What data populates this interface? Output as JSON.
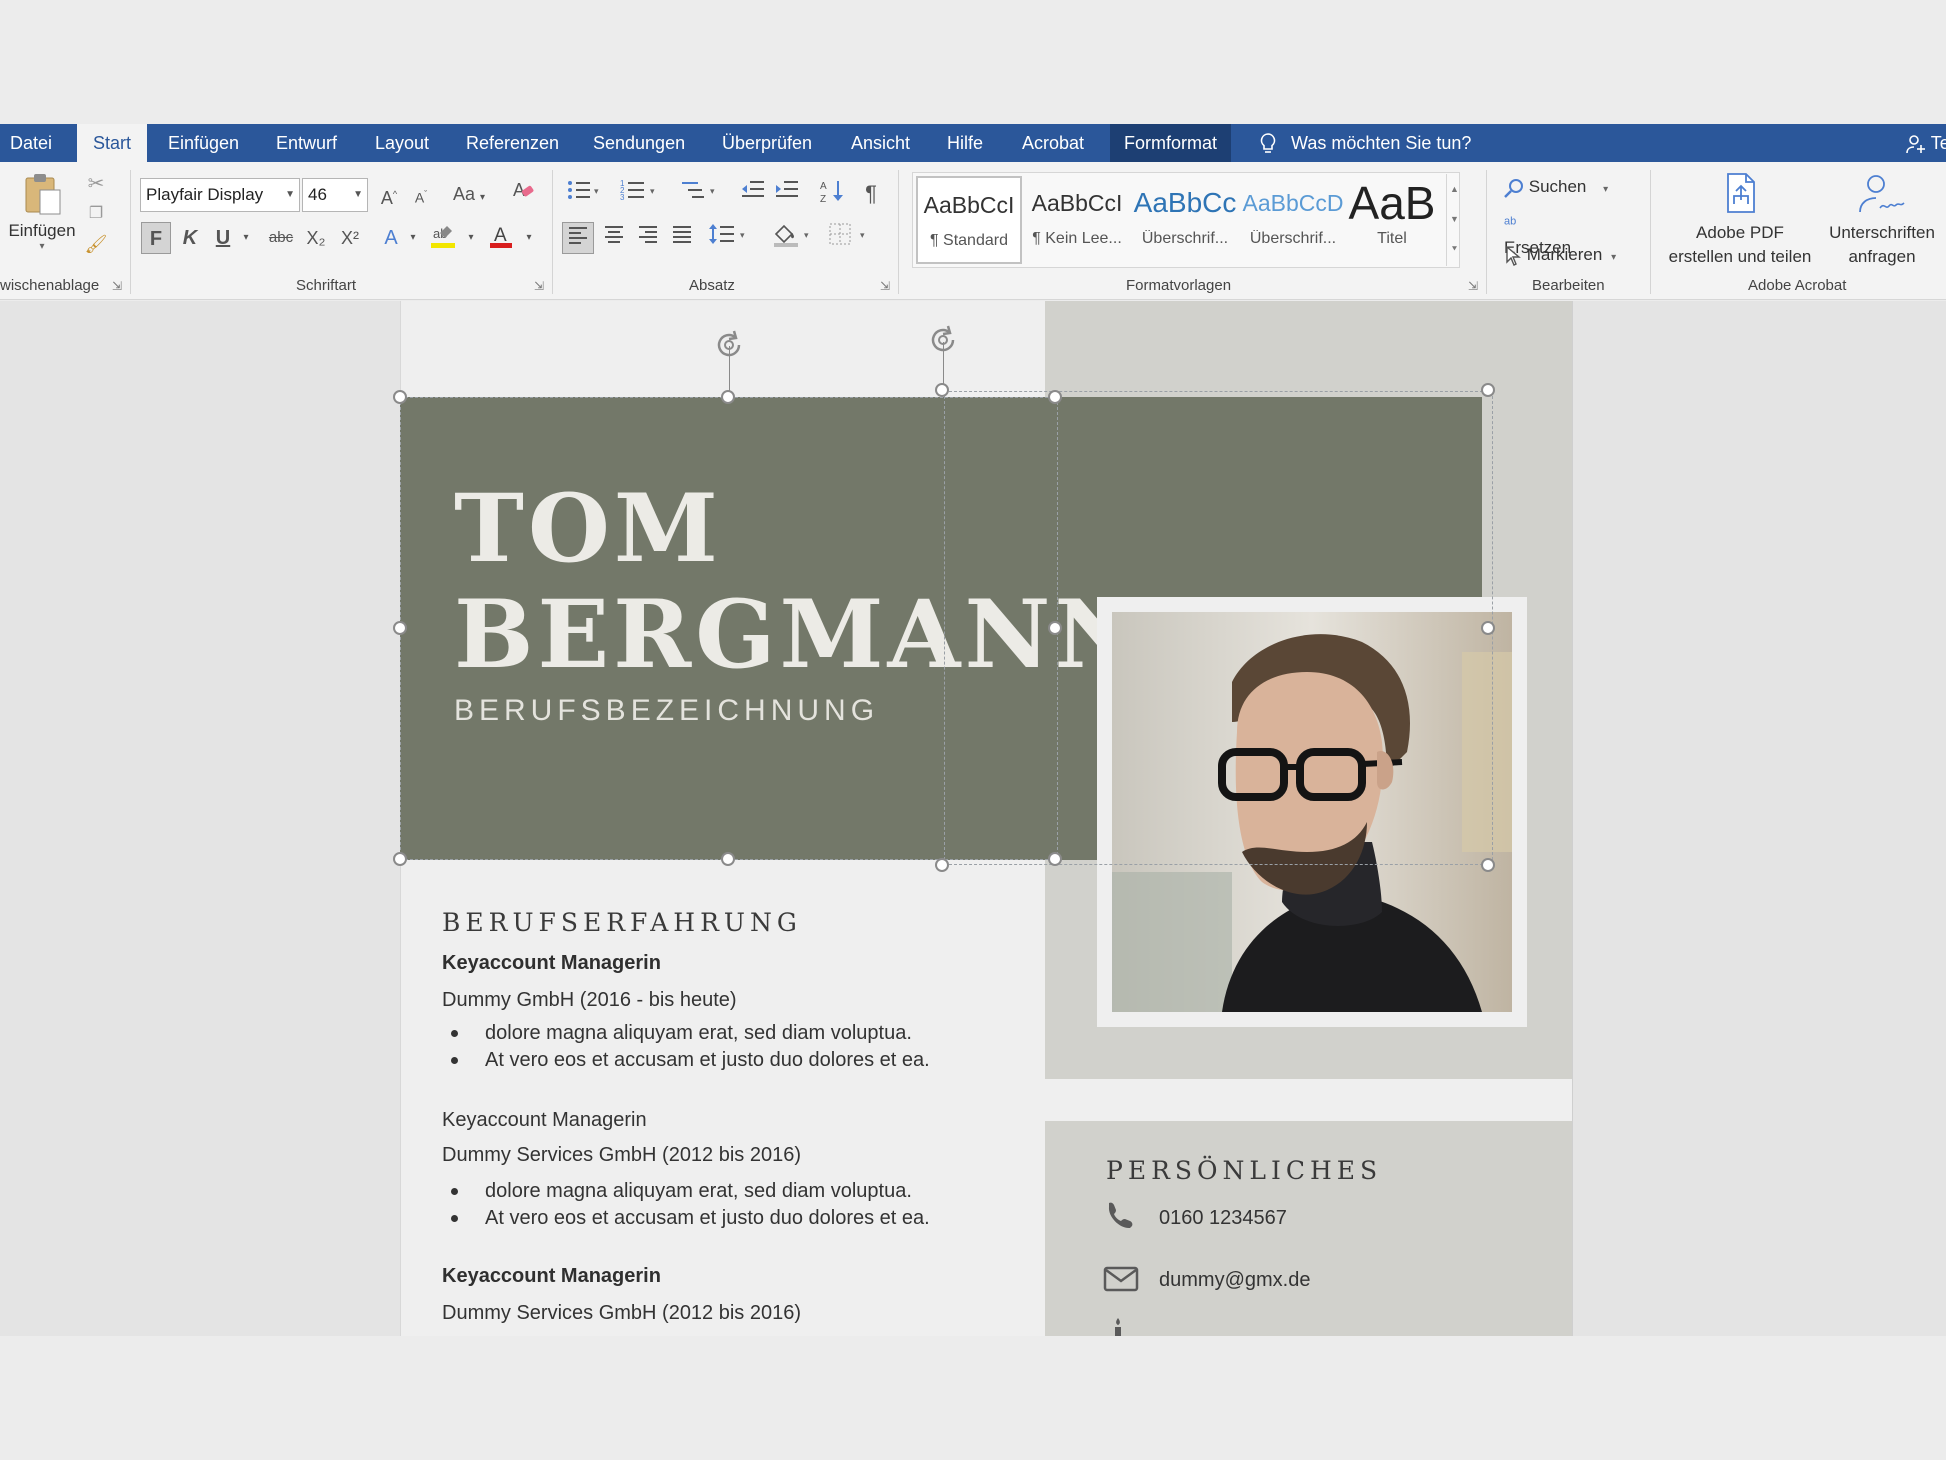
{
  "menu": {
    "tabs": [
      {
        "label": "Datei",
        "active": false
      },
      {
        "label": "Start",
        "active": true
      },
      {
        "label": "Einfügen",
        "active": false
      },
      {
        "label": "Entwurf",
        "active": false
      },
      {
        "label": "Layout",
        "active": false
      },
      {
        "label": "Referenzen",
        "active": false
      },
      {
        "label": "Sendungen",
        "active": false
      },
      {
        "label": "Überprüfen",
        "active": false
      },
      {
        "label": "Ansicht",
        "active": false
      },
      {
        "label": "Hilfe",
        "active": false
      },
      {
        "label": "Acrobat",
        "active": false
      },
      {
        "label": "Formformat",
        "active": false
      }
    ],
    "tell_me": "Was möchten Sie tun?",
    "share_partial": "Te"
  },
  "ribbon": {
    "clipboard": {
      "paste_label": "Einfügen",
      "group_label": "wischenablage"
    },
    "font": {
      "font_name": "Playfair Display",
      "font_size": "46",
      "group_label": "Schriftart",
      "bold": "F",
      "italic": "K",
      "underline": "U",
      "strike": "abc",
      "sub": "X₂",
      "sup": "X²",
      "grow": "A",
      "shrink": "A",
      "case": "Aa"
    },
    "paragraph": {
      "group_label": "Absatz",
      "pilcrow": "¶"
    },
    "styles": {
      "group_label": "Formatvorlagen",
      "items": [
        {
          "sample": "AaBbCcI",
          "name": "¶ Standard",
          "color": "#222222"
        },
        {
          "sample": "AaBbCcI",
          "name": "¶ Kein Lee...",
          "color": "#222222"
        },
        {
          "sample": "AaBbCc",
          "name": "Überschrif...",
          "color": "#2e74b5"
        },
        {
          "sample": "AaBbCcD",
          "name": "Überschrif...",
          "color": "#5b9bd5"
        },
        {
          "sample": "AaB",
          "name": "Titel",
          "color": "#222222"
        }
      ]
    },
    "editing": {
      "group_label": "Bearbeiten",
      "find": "Suchen",
      "replace": "Ersetzen",
      "select": "Markieren"
    },
    "acrobat": {
      "group_label": "Adobe Acrobat",
      "create_pdf_line1": "Adobe PDF",
      "create_pdf_line2": "erstellen und teilen",
      "sign_line1": "Unterschriften",
      "sign_line2": "anfragen"
    }
  },
  "document": {
    "first_name": "TOM",
    "last_name": "BERGMANN",
    "profession": "BERUFSBEZEICHNUNG",
    "header_color": "#737869",
    "experience": {
      "title": "BERUFSERFAHRUNG",
      "jobs": [
        {
          "role": "Keyaccount Managerin",
          "company": "Dummy GmbH (2016 - bis heute)",
          "bullets": [
            "dolore magna aliquyam erat, sed diam voluptua.",
            "At vero eos et accusam et justo duo dolores et ea."
          ]
        },
        {
          "role": "Keyaccount Managerin",
          "company": "Dummy Services GmbH (2012 bis 2016)",
          "bullets": [
            "dolore magna aliquyam erat, sed diam voluptua.",
            "At vero eos et accusam et justo duo dolores et ea."
          ]
        },
        {
          "role": "Keyaccount Managerin",
          "company": "Dummy Services GmbH (2012 bis 2016)",
          "bullets": []
        }
      ]
    },
    "personal": {
      "title": "PERSÖNLICHES",
      "phone": "0160  1234567",
      "email": "dummy@gmx.de"
    }
  }
}
